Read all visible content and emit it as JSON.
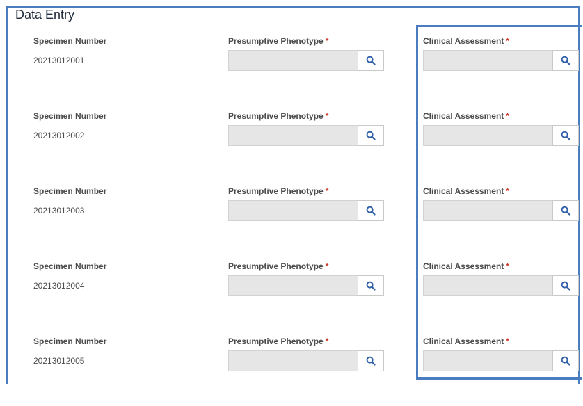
{
  "page": {
    "title": "Data Entry"
  },
  "fields": {
    "specimen_label": "Specimen Number",
    "phenotype_label": "Presumptive Phenotype",
    "assessment_label": "Clinical Assessment",
    "required_marker": "*"
  },
  "colors": {
    "frame": "#4a7cc0",
    "required": "#d0392b",
    "search_icon": "#2f5fa8",
    "input_bg": "#e6e6e6"
  },
  "icons": {
    "lookup": "search-icon"
  },
  "rows": [
    {
      "specimen_number": "20213012001",
      "phenotype_value": "",
      "assessment_value": ""
    },
    {
      "specimen_number": "20213012002",
      "phenotype_value": "",
      "assessment_value": ""
    },
    {
      "specimen_number": "20213012003",
      "phenotype_value": "",
      "assessment_value": ""
    },
    {
      "specimen_number": "20213012004",
      "phenotype_value": "",
      "assessment_value": ""
    },
    {
      "specimen_number": "20213012005",
      "phenotype_value": "",
      "assessment_value": ""
    }
  ]
}
